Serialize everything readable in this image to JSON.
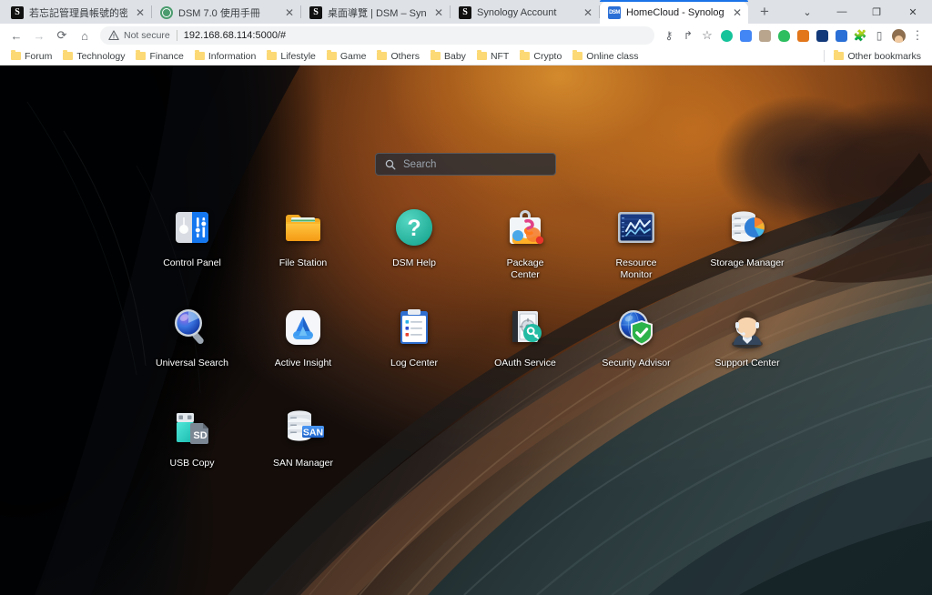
{
  "browser": {
    "tabs": [
      {
        "title": "若忘記管理員帳號的密碼該如何",
        "favicon": "synology-s-icon",
        "active": false
      },
      {
        "title": "DSM 7.0 使用手冊",
        "favicon": "globe-icon",
        "active": false
      },
      {
        "title": "桌面導覽 | DSM – Synology 知",
        "favicon": "synology-s-icon",
        "active": false
      },
      {
        "title": "Synology Account",
        "favicon": "synology-s-icon",
        "active": false
      },
      {
        "title": "HomeCloud - Synology DiskSta",
        "favicon": "dsm-icon",
        "active": true
      }
    ],
    "new_tab_label": "+",
    "close_label": "✕",
    "window_controls": {
      "tab_search": "⌄",
      "minimize": "—",
      "maximize": "❐",
      "close": "✕"
    },
    "nav": {
      "back": "←",
      "forward": "→",
      "reload": "⟳",
      "home": "⌂"
    },
    "omnibox": {
      "warning_icon": "not-secure-icon",
      "security_label": "Not secure",
      "url": "192.168.68.114:5000/#"
    },
    "toolbar_extensions": [
      {
        "name": "password-key-icon",
        "glyph": "⚷",
        "color": "#5f6368"
      },
      {
        "name": "share-icon",
        "glyph": "↱",
        "color": "#5f6368"
      },
      {
        "name": "bookmark-star-icon",
        "glyph": "☆",
        "color": "#5f6368"
      },
      {
        "name": "grammarly-extension-icon",
        "glyph": "G",
        "color": "#15c39a"
      },
      {
        "name": "translate-extension-icon",
        "glyph": "文",
        "color": "#4285f4"
      },
      {
        "name": "screenshot-extension-icon",
        "glyph": "▣",
        "color": "#9aa0a6"
      },
      {
        "name": "evernote-extension-icon",
        "glyph": "🐘",
        "color": "#2dbe60"
      },
      {
        "name": "metamask-extension-icon",
        "glyph": "🦊",
        "color": "#e2761b"
      },
      {
        "name": "dark-reader-extension-icon",
        "glyph": "◑",
        "color": "#1a73e8"
      },
      {
        "name": "pocket-extension-icon",
        "glyph": "▲",
        "color": "#2a6fd6"
      },
      {
        "name": "extensions-puzzle-icon",
        "glyph": "🧩",
        "color": "#5f6368"
      },
      {
        "name": "side-panel-icon",
        "glyph": "▯",
        "color": "#5f6368"
      },
      {
        "name": "profile-avatar-icon",
        "glyph": "",
        "color": "#8d6e4e"
      },
      {
        "name": "chrome-menu-icon",
        "glyph": "⋮",
        "color": "#5f6368"
      }
    ],
    "bookmarks": [
      "Forum",
      "Technology",
      "Finance",
      "Information",
      "Lifestyle",
      "Game",
      "Others",
      "Baby",
      "NFT",
      "Crypto",
      "Online class"
    ],
    "other_bookmarks": "Other bookmarks"
  },
  "desktop": {
    "search": {
      "placeholder": "Search",
      "value": ""
    },
    "apps": [
      {
        "label": "Control Panel",
        "icon": "control-panel-icon"
      },
      {
        "label": "File Station",
        "icon": "file-station-icon"
      },
      {
        "label": "DSM Help",
        "icon": "dsm-help-icon"
      },
      {
        "label": "Package\nCenter",
        "icon": "package-center-icon"
      },
      {
        "label": "Resource\nMonitor",
        "icon": "resource-monitor-icon"
      },
      {
        "label": "Storage Manager",
        "icon": "storage-manager-icon"
      },
      {
        "label": "Universal Search",
        "icon": "universal-search-icon"
      },
      {
        "label": "Active Insight",
        "icon": "active-insight-icon"
      },
      {
        "label": "Log Center",
        "icon": "log-center-icon"
      },
      {
        "label": "OAuth Service",
        "icon": "oauth-service-icon"
      },
      {
        "label": "Security Advisor",
        "icon": "security-advisor-icon"
      },
      {
        "label": "Support Center",
        "icon": "support-center-icon"
      },
      {
        "label": "USB Copy",
        "icon": "usb-copy-icon"
      },
      {
        "label": "SAN Manager",
        "icon": "san-manager-icon"
      }
    ]
  },
  "colors": {
    "chrome_tabstrip": "#dee1e6",
    "chrome_active_tab": "#ffffff",
    "accent_blue": "#1a73e8",
    "bookmark_folder": "#fcd975",
    "search_bg": "#262c34",
    "wallpaper_orange": "#c6721f",
    "wallpaper_dark": "#050608"
  }
}
